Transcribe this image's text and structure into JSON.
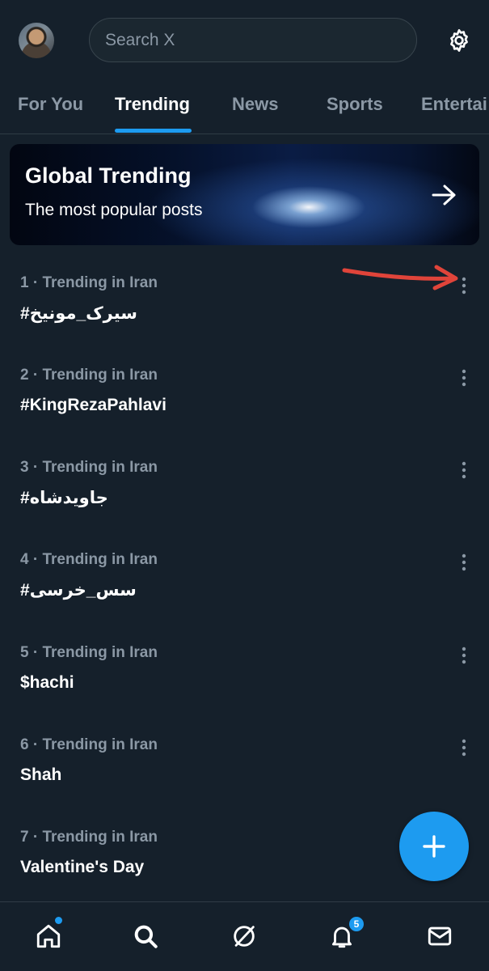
{
  "search": {
    "placeholder": "Search X"
  },
  "tabs": [
    {
      "label": "For You",
      "active": false
    },
    {
      "label": "Trending",
      "active": true
    },
    {
      "label": "News",
      "active": false
    },
    {
      "label": "Sports",
      "active": false
    },
    {
      "label": "Entertai",
      "active": false
    }
  ],
  "banner": {
    "title": "Global Trending",
    "subtitle": "The most popular posts"
  },
  "trends": [
    {
      "meta": "1 · Trending in Iran",
      "name": "#سیرک_مونیخ"
    },
    {
      "meta": "2 · Trending in Iran",
      "name": "#KingRezaPahlavi"
    },
    {
      "meta": "3 · Trending in Iran",
      "name": "#جاویدشاه"
    },
    {
      "meta": "4 · Trending in Iran",
      "name": "#سس_خرسی"
    },
    {
      "meta": "5 · Trending in Iran",
      "name": "$hachi"
    },
    {
      "meta": "6 · Trending in Iran",
      "name": "Shah"
    },
    {
      "meta": "7 · Trending in Iran",
      "name": "Valentine's Day"
    }
  ],
  "bottom_nav": {
    "items": [
      "home-icon",
      "search-icon",
      "grok-icon",
      "notifications-icon",
      "messages-icon"
    ],
    "notifications_count": "5"
  },
  "colors": {
    "background": "#15202b",
    "accent": "#1d9bf0",
    "muted_text": "#8b98a5",
    "annotation": "#e0443a"
  }
}
